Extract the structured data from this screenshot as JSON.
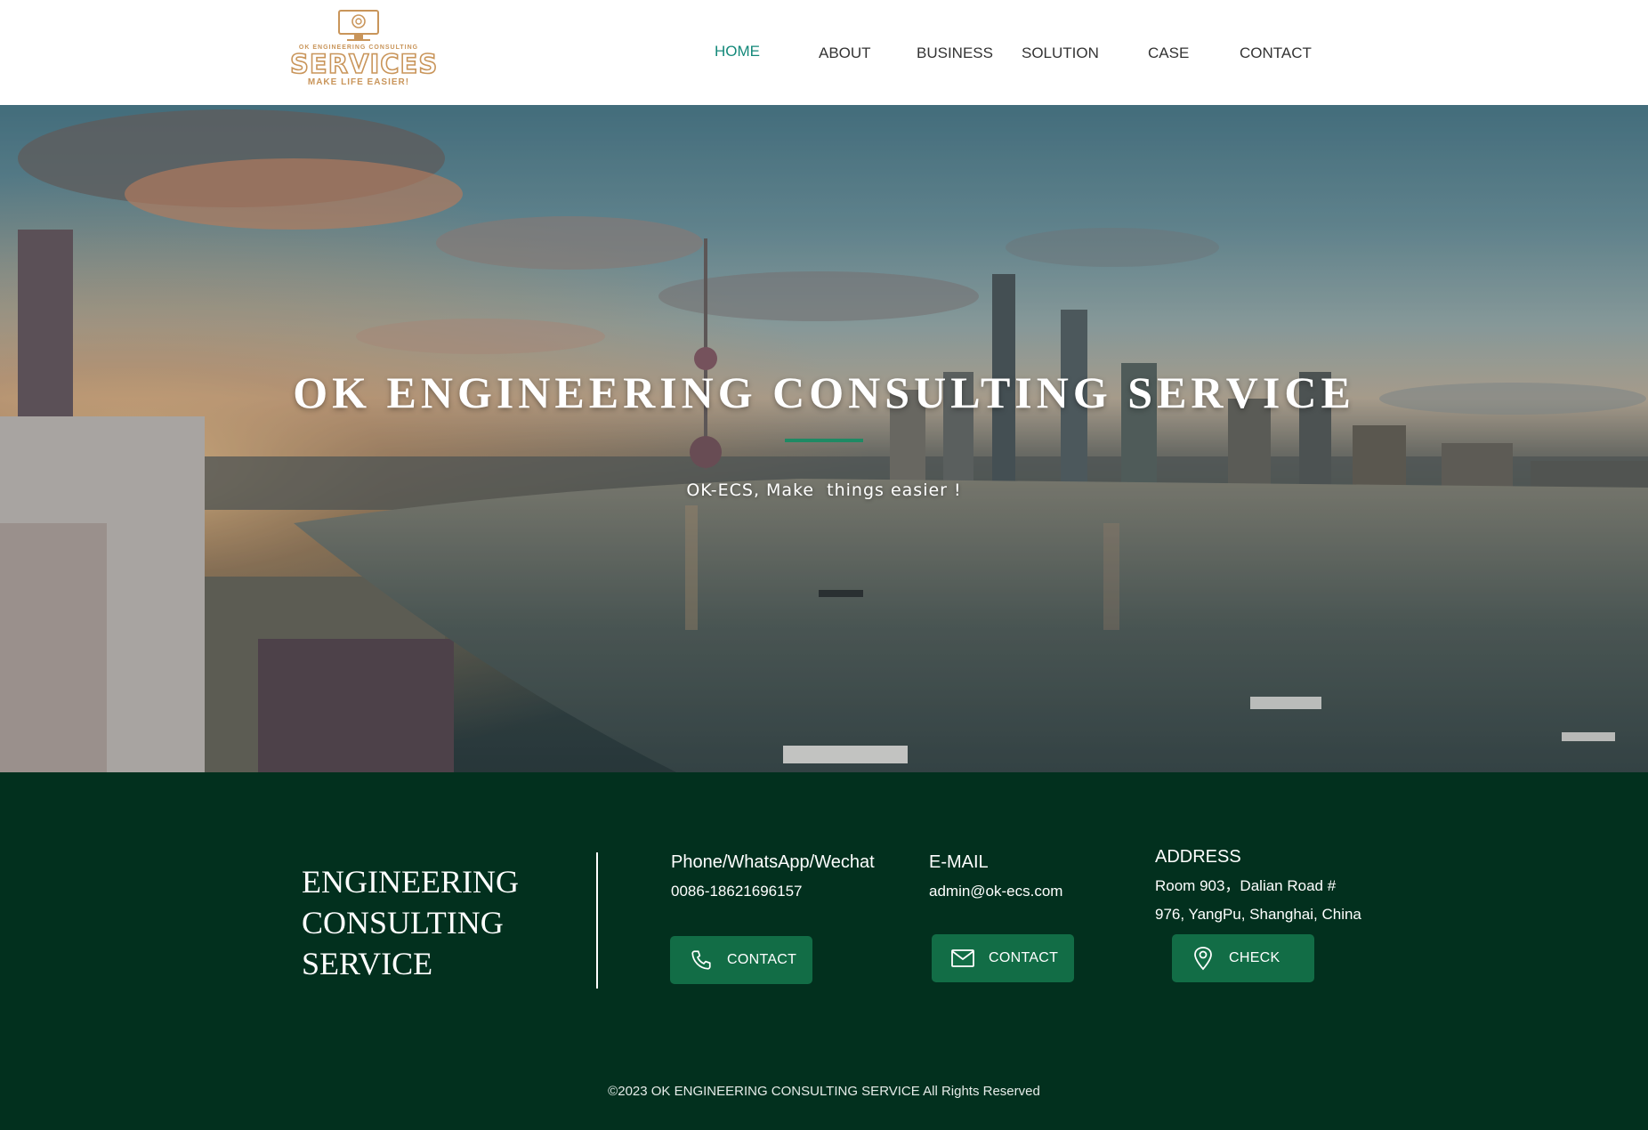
{
  "header": {
    "logo": {
      "small_text": "OK ENGINEERING CONSULTING",
      "main_text": "SERVICES",
      "tagline": "MAKE LIFE EASIER!",
      "accent_color": "#c9955a"
    },
    "nav": [
      {
        "label": "HOME",
        "active": true
      },
      {
        "label": "ABOUT",
        "active": false
      },
      {
        "label": "BUSINESS",
        "active": false
      },
      {
        "label": "SOLUTION",
        "active": false
      },
      {
        "label": "CASE",
        "active": false
      },
      {
        "label": "CONTACT",
        "active": false
      }
    ],
    "active_color": "#14897a"
  },
  "hero": {
    "title": "OK ENGINEERING CONSULTING SERVICE",
    "subtitle": "OK-ECS, Make  things easier !",
    "accent_color": "#1f8a64"
  },
  "footer": {
    "background": "#02301e",
    "brand_lines": [
      "ENGINEERING",
      "CONSULTING",
      "SERVICE"
    ],
    "phone": {
      "title": "Phone/WhatsApp/Wechat",
      "value": "0086-18621696157",
      "button_label": "CONTACT",
      "button_icon": "phone-icon"
    },
    "email": {
      "title": "E-MAIL",
      "value": "admin@ok-ecs.com",
      "button_label": "CONTACT",
      "button_icon": "mail-icon"
    },
    "address": {
      "title": "ADDRESS",
      "line1": "Room 903，Dalian Road #",
      "line2": "976, YangPu, Shanghai, China",
      "button_label": "CHECK",
      "button_icon": "location-pin-icon"
    },
    "button_color": "#126d46",
    "copyright": "©2023 OK ENGINEERING CONSULTING SERVICE All Rights Reserved"
  }
}
